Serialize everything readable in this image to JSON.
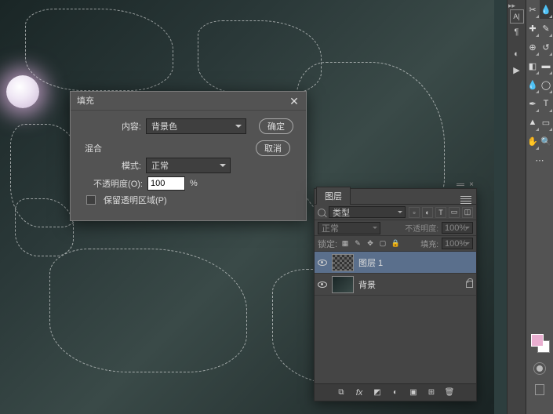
{
  "dialog": {
    "title": "填充",
    "content_label": "内容:",
    "content_value": "背景色",
    "ok": "确定",
    "cancel": "取消",
    "blend_section": "混合",
    "mode_label": "模式:",
    "mode_value": "正常",
    "opacity_label": "不透明度(O):",
    "opacity_value": "100",
    "opacity_unit": "%",
    "preserve_label": "保留透明区域(P)"
  },
  "panel": {
    "tab": "图层",
    "kind_label": "类型",
    "blend_mode": "正常",
    "opacity_label": "不透明度:",
    "opacity_value": "100%",
    "lock_label": "锁定:",
    "fill_label": "填充:",
    "fill_value": "100%",
    "layers": [
      {
        "name": "图层 1",
        "selected": true,
        "locked": false
      },
      {
        "name": "背景",
        "selected": false,
        "locked": true
      }
    ]
  },
  "colors": {
    "fg": "#e9aed0",
    "bg": "#ffffff"
  }
}
